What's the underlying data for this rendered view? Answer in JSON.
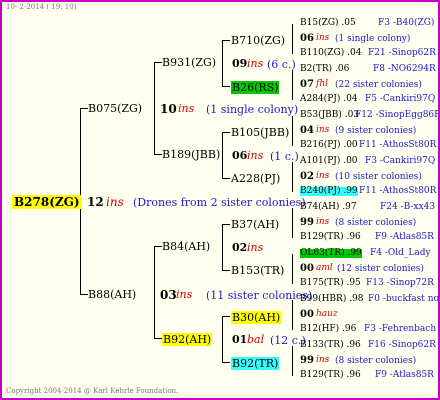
{
  "header": {
    "date_text": "10- 2-2014 ( 19: 10)"
  },
  "footer": {
    "copyright": "Copyright 2004-2014 @ Karl Kehrle Foundation."
  },
  "root": {
    "name": "B278(ZG)",
    "ins_num": "12",
    "ins_word": "ins",
    "note": "(Drones from 2 sister colonies)"
  },
  "gen1": [
    {
      "name": "B075(ZG)",
      "ins_num": "10",
      "ins_word": "ins",
      "note": "(1 single colony)"
    },
    {
      "name": "B88(AH)",
      "ins_num": "03",
      "ins_word": "ins",
      "note": "(11 sister colonies)"
    }
  ],
  "gen2": [
    {
      "name": "B931(ZG)",
      "ins_num": "09",
      "ins_word": "ins",
      "note": "(6 c.)"
    },
    {
      "name": "B189(JBB)",
      "ins_num": "06",
      "ins_word": "ins",
      "note": "(1 c.)"
    },
    {
      "name": "B84(AH)",
      "ins_num": "02",
      "ins_word": "ins",
      "note": ""
    },
    {
      "name": "B92(AH)",
      "ins_num": "01",
      "ins_word": "bal",
      "note": "(12 c.)"
    }
  ],
  "gen3": [
    {
      "name": "B710(ZG)",
      "ins_num": "",
      "ins_word": "",
      "note": ""
    },
    {
      "name": "B26(RS)",
      "ins_num": "",
      "ins_word": "",
      "note": ""
    },
    {
      "name": "B105(JBB)",
      "ins_num": "",
      "ins_word": "",
      "note": ""
    },
    {
      "name": "A228(PJ)",
      "ins_num": "",
      "ins_word": "",
      "note": ""
    },
    {
      "name": "B37(AH)",
      "ins_num": "",
      "ins_word": "",
      "note": ""
    },
    {
      "name": "B153(TR)",
      "ins_num": "",
      "ins_word": "",
      "note": ""
    },
    {
      "name": "B30(AH)",
      "ins_num": "",
      "ins_word": "",
      "note": ""
    },
    {
      "name": "B92(TR)",
      "ins_num": "",
      "ins_word": "",
      "note": ""
    }
  ],
  "gen4": [
    {
      "left": "B15(ZG) .05",
      "right": "F3 -B40(ZG)",
      "ins_num": "06",
      "ins_word": "ins",
      "note": "(1 single colony)",
      "low_left": "B110(ZG) .04",
      "low_right": "F21 -Sinop62R"
    },
    {
      "left": "B2(TR) .06",
      "right": "F8 -NO6294R",
      "ins_num": "07",
      "ins_word": "fhl",
      "note": "(22 sister colonies)",
      "low_left": "A284(PJ) .04",
      "low_right": "F5 -Cankiri97Q"
    },
    {
      "left": "B53(JBB) .03",
      "right": "F12 -SinopEgg86R",
      "ins_num": "04",
      "ins_word": "ins",
      "note": "(9 sister colonies)",
      "low_left": "B216(PJ) .00",
      "low_right": "F11 -AthosSt80R"
    },
    {
      "left": "A101(PJ) .00",
      "right": "F3 -Cankiri97Q",
      "ins_num": "02",
      "ins_word": "ins",
      "note": "(10 sister colonies)",
      "low_left": "B240(PJ) .99",
      "low_right": "F11 -AthosSt80R"
    },
    {
      "left": "B74(AH) .97",
      "right": "F24 -B-xx43",
      "ins_num": "99",
      "ins_word": "ins",
      "note": "(8 sister colonies)",
      "low_left": "B129(TR) .96",
      "low_right": "F9 -Atlas85R"
    },
    {
      "left": "OL63(TR) .99",
      "right": "F4 -Old_Lady",
      "ins_num": "00",
      "ins_word": "aml",
      "note": "(12 sister colonies)",
      "low_left": "B175(TR) .95",
      "low_right": "F13 -Sinop72R"
    },
    {
      "left": "B99(HBR) .98",
      "right": "F0 -buckfast not",
      "ins_num": "00",
      "ins_word": "hauz",
      "note": "",
      "low_left": "B12(HF) .96",
      "low_right": "F3 -Fehrenbach"
    },
    {
      "left": "B133(TR) .96",
      "right": "F16 -Sinop62R",
      "ins_num": "99",
      "ins_word": "ins",
      "note": "(8 sister colonies)",
      "low_left": "B129(TR) .96",
      "low_right": "F9 -Atlas85R"
    }
  ],
  "colors": {
    "frame": "#c400c4",
    "background": "#fffff0",
    "highlight_yellow": "#ffff00",
    "highlight_green": "#00c800",
    "highlight_cyan": "#33ffff",
    "ins_red": "#d40000",
    "link_blue": "#1a1acc"
  }
}
